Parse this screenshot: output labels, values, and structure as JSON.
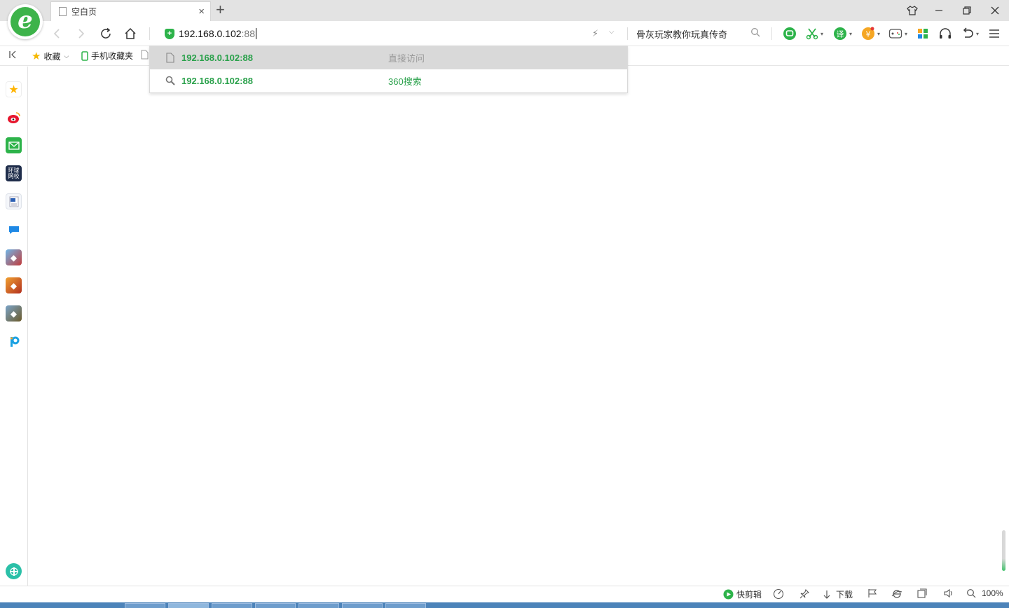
{
  "browser": {
    "logo_letter": "e",
    "accent": "#2db34a"
  },
  "tab": {
    "title": "空白页",
    "close_glyph": "×"
  },
  "new_tab_glyph": "+",
  "address": {
    "host": "192.168.0.102",
    "port": ":88"
  },
  "search": {
    "query": "骨灰玩家教你玩真传奇"
  },
  "bookmarks": {
    "favorites_label": "收藏",
    "mobile_label": "手机收藏夹"
  },
  "suggestions": [
    {
      "url": "192.168.0.102:88",
      "action": "直接访问",
      "icon": "page-icon",
      "action_color": "#999999",
      "active": true
    },
    {
      "url": "192.168.0.102:88",
      "action": "360搜索",
      "icon": "search-icon",
      "action_color": "#2aa14b",
      "active": false
    }
  ],
  "sidebar": {
    "items": [
      {
        "name": "favorites-star-icon",
        "color": "#ffb400",
        "glyph": "★"
      },
      {
        "name": "weibo-icon",
        "color": "#e6162d",
        "glyph": "微"
      },
      {
        "name": "mail-icon",
        "color": "#2db34a",
        "glyph": "✉"
      },
      {
        "name": "global-news-icon",
        "color": "#1f2d4b",
        "glyph": "环球"
      },
      {
        "name": "word-doc-icon",
        "color": "#2b5fb4",
        "glyph": "W"
      },
      {
        "name": "chat-icon",
        "color": "#1e88e5",
        "glyph": "▬"
      },
      {
        "name": "game-app-1-icon",
        "color": "#4a90c2",
        "glyph": "◆"
      },
      {
        "name": "game-app-2-icon",
        "color": "#d9532b",
        "glyph": "◆"
      },
      {
        "name": "game-app-3-icon",
        "color": "#6b7a3a",
        "glyph": "◆"
      },
      {
        "name": "pp-assistant-icon",
        "color": "#1ba1e2",
        "glyph": "P"
      }
    ]
  },
  "statusbar": {
    "quick_clip_label": "快剪辑",
    "download_label": "下载",
    "zoom": "100%"
  }
}
